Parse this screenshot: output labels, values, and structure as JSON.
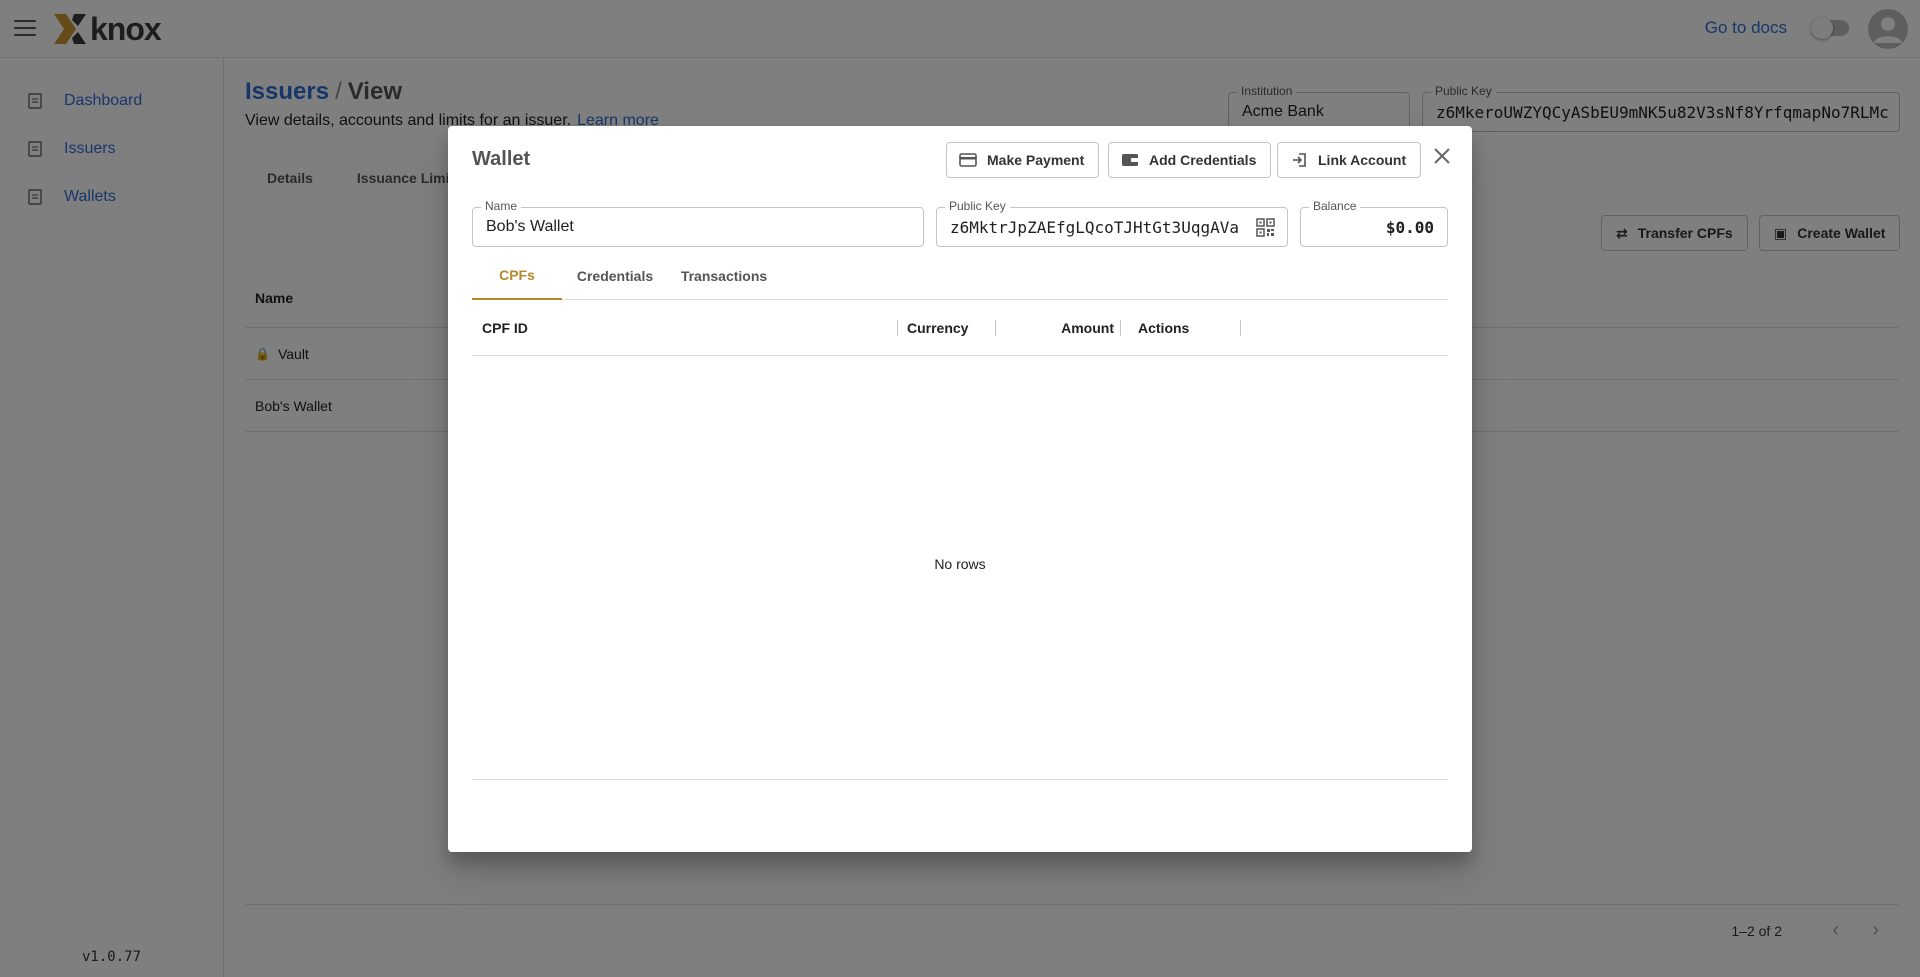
{
  "app": {
    "brand": "knox",
    "docs_link": "Go to docs",
    "version": "v1.0.77"
  },
  "sidebar": {
    "items": [
      {
        "label": "Dashboard"
      },
      {
        "label": "Issuers"
      },
      {
        "label": "Wallets"
      }
    ]
  },
  "page": {
    "breadcrumb_link": "Issuers",
    "breadcrumb_separator": "/",
    "breadcrumb_current": "View",
    "subtitle": "View details, accounts and limits for an issuer.",
    "learn_more": "Learn more",
    "institution_label": "Institution",
    "institution_value": "Acme Bank",
    "public_key_label": "Public Key",
    "public_key_value": "z6MkeroUWZYQCyASbEU9mNK5u82V3sNf8YrfqmapNo7RLMc",
    "tabs": [
      "Details",
      "Issuance Limit"
    ],
    "transfer_button": "Transfer CPFs",
    "create_button": "Create Wallet",
    "table_header_name": "Name",
    "rows": [
      {
        "name": "Vault",
        "locked": true
      },
      {
        "name": "Bob's Wallet",
        "locked": false
      }
    ],
    "pagination": "1–2 of 2"
  },
  "dialog": {
    "title": "Wallet",
    "make_payment": "Make Payment",
    "add_credentials": "Add Credentials",
    "link_account": "Link Account",
    "name_label": "Name",
    "name_value": "Bob's Wallet",
    "public_key_label": "Public Key",
    "public_key_value": "z6MktrJpZAEfgLQcoTJHtGt3UqgAVa",
    "balance_label": "Balance",
    "balance_value": "$0.00",
    "tabs": [
      "CPFs",
      "Credentials",
      "Transactions"
    ],
    "active_tab": "CPFs",
    "columns": [
      "CPF ID",
      "Currency",
      "Amount",
      "Actions"
    ],
    "empty_text": "No rows"
  },
  "colors": {
    "primary": "#2f6fd6",
    "accent": "#b8882c",
    "logo_gold": "#c9962e"
  },
  "icons": [
    "menu-icon",
    "knox-logo-icon",
    "account-circle-icon",
    "document-icon",
    "lock-icon",
    "credit-card-icon",
    "wallet-icon",
    "login-icon",
    "close-icon",
    "qr-code-icon",
    "transfer-icon",
    "chevron-left-icon",
    "chevron-right-icon"
  ]
}
